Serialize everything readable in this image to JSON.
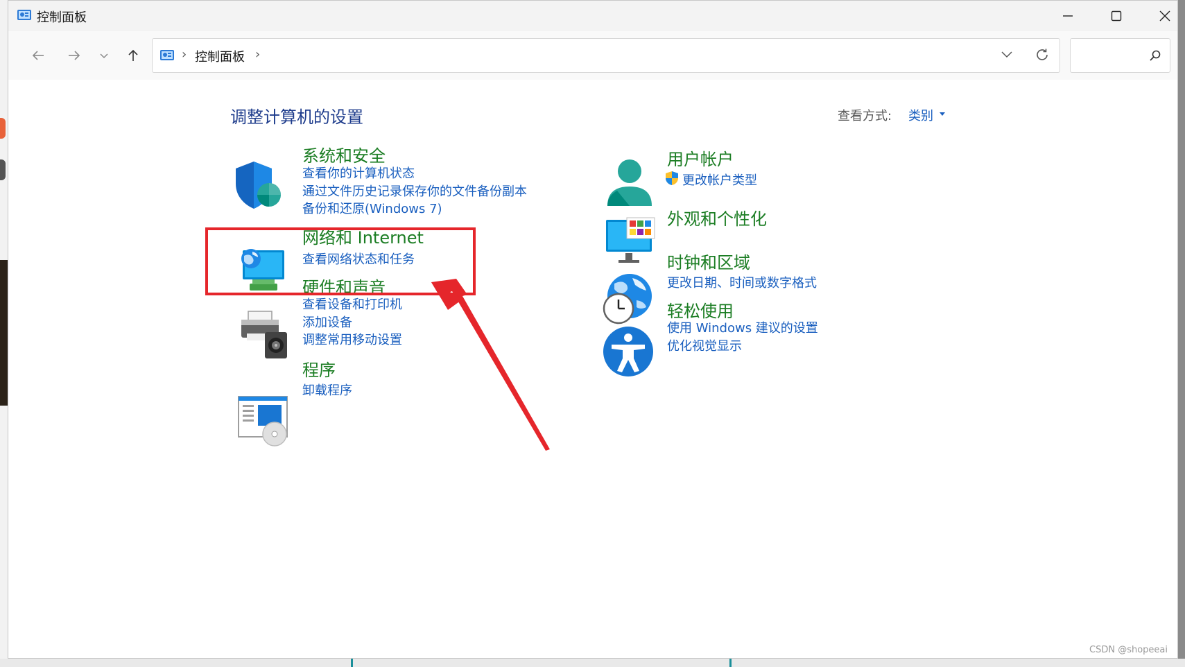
{
  "window": {
    "title": "控制面板",
    "buttons": [
      "minimize",
      "maximize",
      "close"
    ]
  },
  "nav": {
    "breadcrumb": [
      "控制面板"
    ],
    "separator": "›",
    "search_placeholder": ""
  },
  "content": {
    "heading": "调整计算机的设置",
    "view_by_label": "查看方式:",
    "view_by_value": "类别"
  },
  "categories_left": [
    {
      "title": "系统和安全",
      "icon": "shield-icon",
      "links": [
        "查看你的计算机状态",
        "通过文件历史记录保存你的文件备份副本",
        "备份和还原(Windows 7)"
      ]
    },
    {
      "title": "网络和 Internet",
      "icon": "network-icon",
      "links": [
        "查看网络状态和任务"
      ]
    },
    {
      "title": "硬件和声音",
      "icon": "printer-icon",
      "links": [
        "查看设备和打印机",
        "添加设备",
        "调整常用移动设置"
      ]
    },
    {
      "title": "程序",
      "icon": "programs-icon",
      "links": [
        "卸载程序"
      ]
    }
  ],
  "categories_right": [
    {
      "title": "用户帐户",
      "icon": "user-icon",
      "links": [
        "更改帐户类型"
      ]
    },
    {
      "title": "外观和个性化",
      "icon": "appearance-icon",
      "links": []
    },
    {
      "title": "时钟和区域",
      "icon": "clock-globe-icon",
      "links": [
        "更改日期、时间或数字格式"
      ]
    },
    {
      "title": "轻松使用",
      "icon": "accessibility-icon",
      "links": [
        "使用 Windows 建议的设置",
        "优化视觉显示"
      ]
    }
  ],
  "annotation": {
    "highlight_color": "#e5262b"
  },
  "watermark": "CSDN @shopeeai",
  "colors": {
    "title_green": "#1b7d23",
    "link_blue": "#1a5fbf",
    "heading_blue": "#1e3c8c"
  }
}
